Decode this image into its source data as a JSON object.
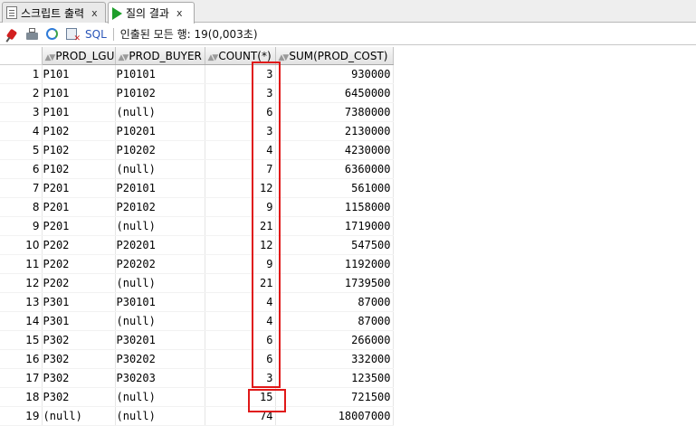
{
  "tabs": [
    {
      "label": "스크립트 출력",
      "close": "x",
      "icon": "script-icon",
      "active": false
    },
    {
      "label": "질의 결과",
      "close": "x",
      "icon": "run-icon",
      "active": true
    }
  ],
  "toolbar": {
    "sql_label": "SQL",
    "status": "인출된 모든 행: 19(0,003초)"
  },
  "grid": {
    "columns": [
      "PROD_LGU",
      "PROD_BUYER",
      "COUNT(*)",
      "SUM(PROD_COST)"
    ],
    "rows": [
      [
        "1",
        "P101",
        "P10101",
        "3",
        "930000"
      ],
      [
        "2",
        "P101",
        "P10102",
        "3",
        "6450000"
      ],
      [
        "3",
        "P101",
        "(null)",
        "6",
        "7380000"
      ],
      [
        "4",
        "P102",
        "P10201",
        "3",
        "2130000"
      ],
      [
        "5",
        "P102",
        "P10202",
        "4",
        "4230000"
      ],
      [
        "6",
        "P102",
        "(null)",
        "7",
        "6360000"
      ],
      [
        "7",
        "P201",
        "P20101",
        "12",
        "561000"
      ],
      [
        "8",
        "P201",
        "P20102",
        "9",
        "1158000"
      ],
      [
        "9",
        "P201",
        "(null)",
        "21",
        "1719000"
      ],
      [
        "10",
        "P202",
        "P20201",
        "12",
        "547500"
      ],
      [
        "11",
        "P202",
        "P20202",
        "9",
        "1192000"
      ],
      [
        "12",
        "P202",
        "(null)",
        "21",
        "1739500"
      ],
      [
        "13",
        "P301",
        "P30101",
        "4",
        "87000"
      ],
      [
        "14",
        "P301",
        "(null)",
        "4",
        "87000"
      ],
      [
        "15",
        "P302",
        "P30201",
        "6",
        "266000"
      ],
      [
        "16",
        "P302",
        "P30202",
        "6",
        "332000"
      ],
      [
        "17",
        "P302",
        "P30203",
        "3",
        "123500"
      ],
      [
        "18",
        "P302",
        "(null)",
        "15",
        "721500"
      ],
      [
        "19",
        "(null)",
        "(null)",
        "74",
        "18007000"
      ]
    ]
  },
  "highlight_color": "#e01818"
}
